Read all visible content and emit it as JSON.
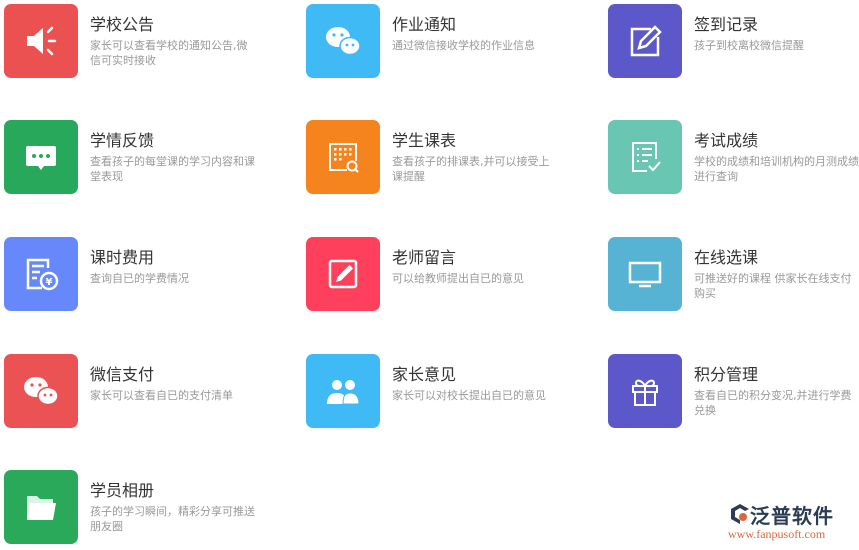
{
  "features": [
    {
      "title": "学校公告",
      "desc": "家长可以查看学校的通知公告,微信可实时接收",
      "icon": "megaphone-icon",
      "color": "#ec5152"
    },
    {
      "title": "作业通知",
      "desc": "通过微信接收学校的作业信息",
      "icon": "wechat-icon",
      "color": "#3fbaf5"
    },
    {
      "title": "签到记录",
      "desc": "孩子到校离校微信提醒",
      "icon": "edit-icon",
      "color": "#5d58ca"
    },
    {
      "title": "学情反馈",
      "desc": "查看孩子的每堂课的学习内容和课堂表现",
      "icon": "chat-bubble-icon",
      "color": "#28a85a"
    },
    {
      "title": "学生课表",
      "desc": "查看孩子的排课表,并可以接受上课提醒",
      "icon": "schedule-search-icon",
      "color": "#f5841f"
    },
    {
      "title": "考试成绩",
      "desc": "学校的成绩和培训机构的月测成绩进行查询",
      "icon": "checklist-icon",
      "color": "#68c6b3"
    },
    {
      "title": "课时费用",
      "desc": "查询自已的学费情况",
      "icon": "fee-icon",
      "color": "#6788fa"
    },
    {
      "title": "老师留言",
      "desc": "可以给教师提出自已的意见",
      "icon": "pencil-square-icon",
      "color": "#ff405c"
    },
    {
      "title": "在线选课",
      "desc": "可推送好的课程 供家长在线支付购买",
      "icon": "monitor-icon",
      "color": "#57b3d3"
    },
    {
      "title": "微信支付",
      "desc": "家长可以查看自已的支付清单",
      "icon": "wechat-icon",
      "color": "#ea5253"
    },
    {
      "title": "家长意见",
      "desc": "家长可以对校长提出自已的意见",
      "icon": "users-icon",
      "color": "#3fbaf5"
    },
    {
      "title": "积分管理",
      "desc": "查看自已的积分变况,并进行学费兑换",
      "icon": "gift-icon",
      "color": "#5d58ca"
    },
    {
      "title": "学员相册",
      "desc": "孩子的学习瞬间，精彩分享可推送朋友圈",
      "icon": "folder-icon",
      "color": "#2aa95a"
    }
  ],
  "logo": {
    "brand": "泛普软件",
    "url": "www.fanpusoft.com"
  }
}
